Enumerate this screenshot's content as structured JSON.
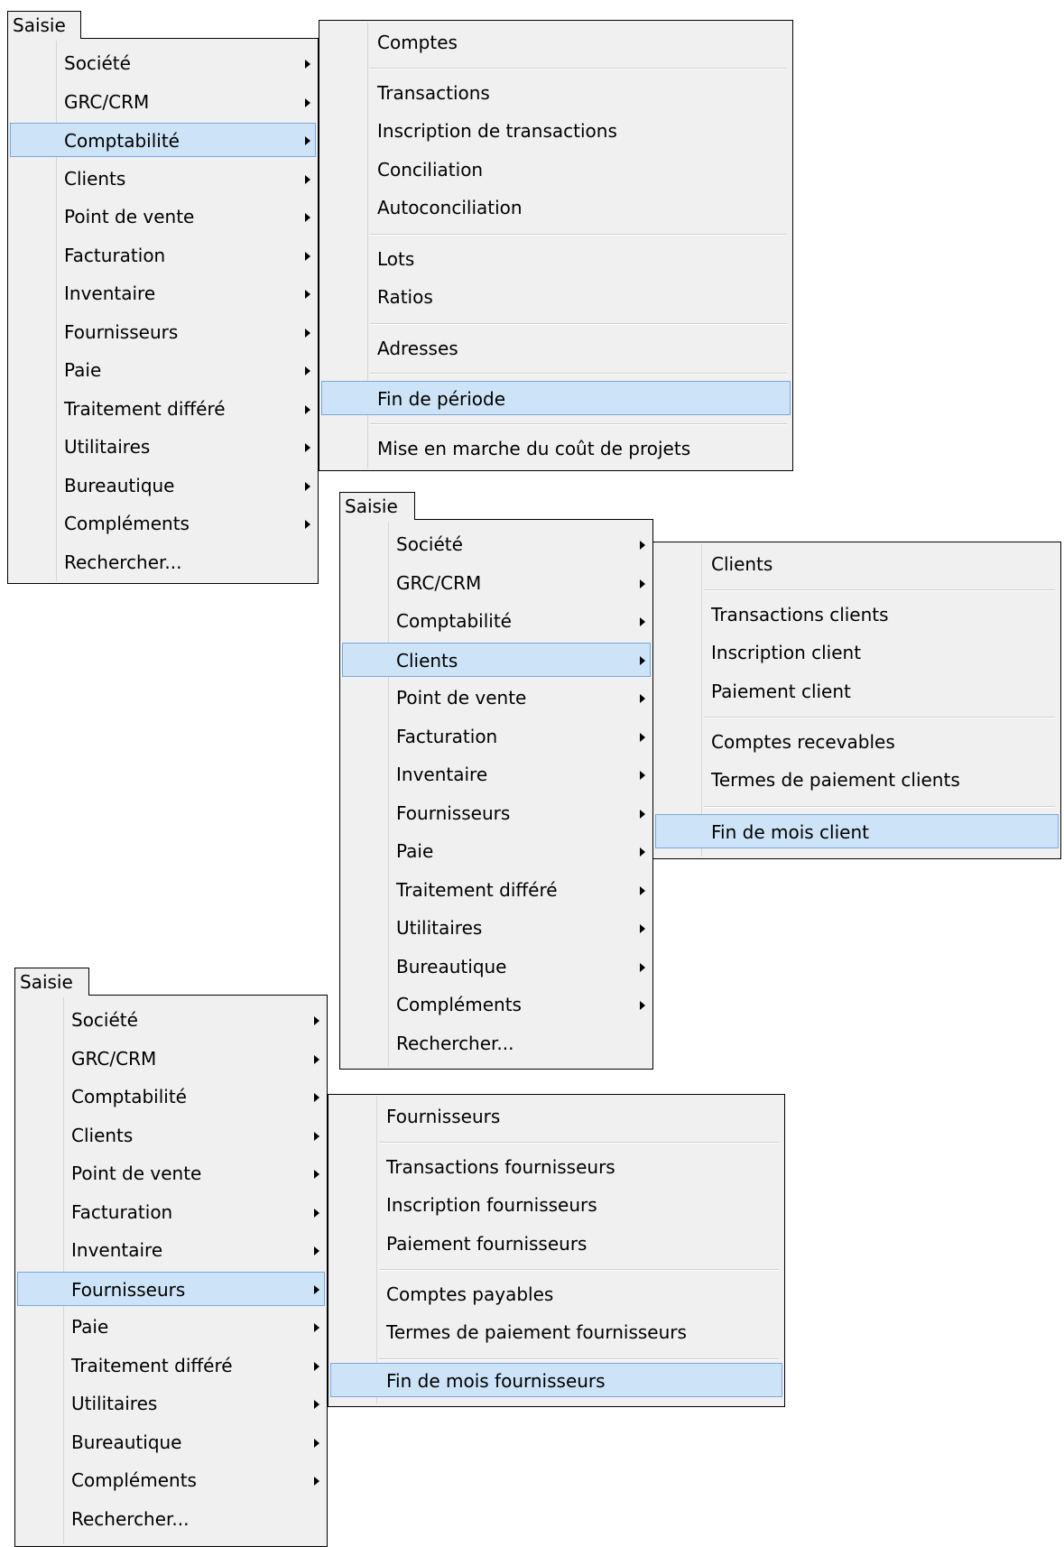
{
  "menu1": {
    "title": "Saisie",
    "items": [
      {
        "label": "Société"
      },
      {
        "label": "GRC/CRM"
      },
      {
        "label": "Comptabilité"
      },
      {
        "label": "Clients"
      },
      {
        "label": "Point de vente"
      },
      {
        "label": "Facturation"
      },
      {
        "label": "Inventaire"
      },
      {
        "label": "Fournisseurs"
      },
      {
        "label": "Paie"
      },
      {
        "label": "Traitement différé"
      },
      {
        "label": "Utilitaires"
      },
      {
        "label": "Bureautique"
      },
      {
        "label": "Compléments"
      },
      {
        "label": "Rechercher..."
      }
    ],
    "submenu": [
      {
        "label": "Comptes"
      },
      {
        "label": "Transactions"
      },
      {
        "label": "Inscription de transactions"
      },
      {
        "label": "Conciliation"
      },
      {
        "label": "Autoconciliation"
      },
      {
        "label": "Lots"
      },
      {
        "label": "Ratios"
      },
      {
        "label": "Adresses"
      },
      {
        "label": "Fin de période"
      },
      {
        "label": "Mise en marche du coût de projets"
      }
    ]
  },
  "menu2": {
    "title": "Saisie",
    "items": [
      {
        "label": "Société"
      },
      {
        "label": "GRC/CRM"
      },
      {
        "label": "Comptabilité"
      },
      {
        "label": "Clients"
      },
      {
        "label": "Point de vente"
      },
      {
        "label": "Facturation"
      },
      {
        "label": "Inventaire"
      },
      {
        "label": "Fournisseurs"
      },
      {
        "label": "Paie"
      },
      {
        "label": "Traitement différé"
      },
      {
        "label": "Utilitaires"
      },
      {
        "label": "Bureautique"
      },
      {
        "label": "Compléments"
      },
      {
        "label": "Rechercher..."
      }
    ],
    "submenu": [
      {
        "label": "Clients"
      },
      {
        "label": "Transactions clients"
      },
      {
        "label": "Inscription client"
      },
      {
        "label": "Paiement client"
      },
      {
        "label": "Comptes recevables"
      },
      {
        "label": "Termes de paiement clients"
      },
      {
        "label": "Fin de mois client"
      }
    ]
  },
  "menu3": {
    "title": "Saisie",
    "items": [
      {
        "label": "Société"
      },
      {
        "label": "GRC/CRM"
      },
      {
        "label": "Comptabilité"
      },
      {
        "label": "Clients"
      },
      {
        "label": "Point de vente"
      },
      {
        "label": "Facturation"
      },
      {
        "label": "Inventaire"
      },
      {
        "label": "Fournisseurs"
      },
      {
        "label": "Paie"
      },
      {
        "label": "Traitement différé"
      },
      {
        "label": "Utilitaires"
      },
      {
        "label": "Bureautique"
      },
      {
        "label": "Compléments"
      },
      {
        "label": "Rechercher..."
      }
    ],
    "submenu": [
      {
        "label": "Fournisseurs"
      },
      {
        "label": "Transactions fournisseurs"
      },
      {
        "label": "Inscription fournisseurs"
      },
      {
        "label": "Paiement fournisseurs"
      },
      {
        "label": "Comptes payables"
      },
      {
        "label": "Termes de paiement fournisseurs"
      },
      {
        "label": "Fin de mois fournisseurs"
      }
    ]
  },
  "colors": {
    "menu_bg": "#f0f0f0",
    "highlight_bg": "#cde3f7",
    "highlight_border": "#7aa7e0"
  }
}
